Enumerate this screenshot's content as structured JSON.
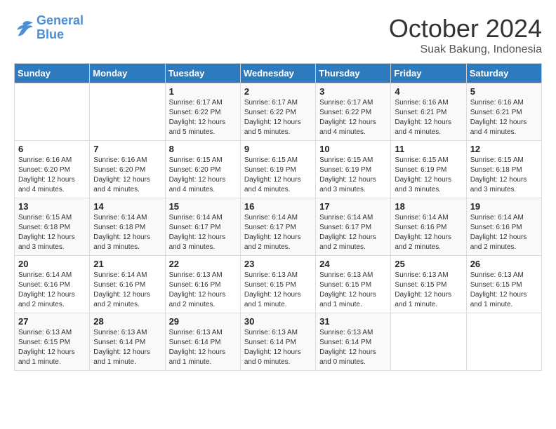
{
  "header": {
    "logo_line1": "General",
    "logo_line2": "Blue",
    "month_title": "October 2024",
    "subtitle": "Suak Bakung, Indonesia"
  },
  "days_of_week": [
    "Sunday",
    "Monday",
    "Tuesday",
    "Wednesday",
    "Thursday",
    "Friday",
    "Saturday"
  ],
  "weeks": [
    [
      {
        "day": "",
        "info": ""
      },
      {
        "day": "",
        "info": ""
      },
      {
        "day": "1",
        "info": "Sunrise: 6:17 AM\nSunset: 6:22 PM\nDaylight: 12 hours\nand 5 minutes."
      },
      {
        "day": "2",
        "info": "Sunrise: 6:17 AM\nSunset: 6:22 PM\nDaylight: 12 hours\nand 5 minutes."
      },
      {
        "day": "3",
        "info": "Sunrise: 6:17 AM\nSunset: 6:22 PM\nDaylight: 12 hours\nand 4 minutes."
      },
      {
        "day": "4",
        "info": "Sunrise: 6:16 AM\nSunset: 6:21 PM\nDaylight: 12 hours\nand 4 minutes."
      },
      {
        "day": "5",
        "info": "Sunrise: 6:16 AM\nSunset: 6:21 PM\nDaylight: 12 hours\nand 4 minutes."
      }
    ],
    [
      {
        "day": "6",
        "info": "Sunrise: 6:16 AM\nSunset: 6:20 PM\nDaylight: 12 hours\nand 4 minutes."
      },
      {
        "day": "7",
        "info": "Sunrise: 6:16 AM\nSunset: 6:20 PM\nDaylight: 12 hours\nand 4 minutes."
      },
      {
        "day": "8",
        "info": "Sunrise: 6:15 AM\nSunset: 6:20 PM\nDaylight: 12 hours\nand 4 minutes."
      },
      {
        "day": "9",
        "info": "Sunrise: 6:15 AM\nSunset: 6:19 PM\nDaylight: 12 hours\nand 4 minutes."
      },
      {
        "day": "10",
        "info": "Sunrise: 6:15 AM\nSunset: 6:19 PM\nDaylight: 12 hours\nand 3 minutes."
      },
      {
        "day": "11",
        "info": "Sunrise: 6:15 AM\nSunset: 6:19 PM\nDaylight: 12 hours\nand 3 minutes."
      },
      {
        "day": "12",
        "info": "Sunrise: 6:15 AM\nSunset: 6:18 PM\nDaylight: 12 hours\nand 3 minutes."
      }
    ],
    [
      {
        "day": "13",
        "info": "Sunrise: 6:15 AM\nSunset: 6:18 PM\nDaylight: 12 hours\nand 3 minutes."
      },
      {
        "day": "14",
        "info": "Sunrise: 6:14 AM\nSunset: 6:18 PM\nDaylight: 12 hours\nand 3 minutes."
      },
      {
        "day": "15",
        "info": "Sunrise: 6:14 AM\nSunset: 6:17 PM\nDaylight: 12 hours\nand 3 minutes."
      },
      {
        "day": "16",
        "info": "Sunrise: 6:14 AM\nSunset: 6:17 PM\nDaylight: 12 hours\nand 2 minutes."
      },
      {
        "day": "17",
        "info": "Sunrise: 6:14 AM\nSunset: 6:17 PM\nDaylight: 12 hours\nand 2 minutes."
      },
      {
        "day": "18",
        "info": "Sunrise: 6:14 AM\nSunset: 6:16 PM\nDaylight: 12 hours\nand 2 minutes."
      },
      {
        "day": "19",
        "info": "Sunrise: 6:14 AM\nSunset: 6:16 PM\nDaylight: 12 hours\nand 2 minutes."
      }
    ],
    [
      {
        "day": "20",
        "info": "Sunrise: 6:14 AM\nSunset: 6:16 PM\nDaylight: 12 hours\nand 2 minutes."
      },
      {
        "day": "21",
        "info": "Sunrise: 6:14 AM\nSunset: 6:16 PM\nDaylight: 12 hours\nand 2 minutes."
      },
      {
        "day": "22",
        "info": "Sunrise: 6:13 AM\nSunset: 6:16 PM\nDaylight: 12 hours\nand 2 minutes."
      },
      {
        "day": "23",
        "info": "Sunrise: 6:13 AM\nSunset: 6:15 PM\nDaylight: 12 hours\nand 1 minute."
      },
      {
        "day": "24",
        "info": "Sunrise: 6:13 AM\nSunset: 6:15 PM\nDaylight: 12 hours\nand 1 minute."
      },
      {
        "day": "25",
        "info": "Sunrise: 6:13 AM\nSunset: 6:15 PM\nDaylight: 12 hours\nand 1 minute."
      },
      {
        "day": "26",
        "info": "Sunrise: 6:13 AM\nSunset: 6:15 PM\nDaylight: 12 hours\nand 1 minute."
      }
    ],
    [
      {
        "day": "27",
        "info": "Sunrise: 6:13 AM\nSunset: 6:15 PM\nDaylight: 12 hours\nand 1 minute."
      },
      {
        "day": "28",
        "info": "Sunrise: 6:13 AM\nSunset: 6:14 PM\nDaylight: 12 hours\nand 1 minute."
      },
      {
        "day": "29",
        "info": "Sunrise: 6:13 AM\nSunset: 6:14 PM\nDaylight: 12 hours\nand 1 minute."
      },
      {
        "day": "30",
        "info": "Sunrise: 6:13 AM\nSunset: 6:14 PM\nDaylight: 12 hours\nand 0 minutes."
      },
      {
        "day": "31",
        "info": "Sunrise: 6:13 AM\nSunset: 6:14 PM\nDaylight: 12 hours\nand 0 minutes."
      },
      {
        "day": "",
        "info": ""
      },
      {
        "day": "",
        "info": ""
      }
    ]
  ]
}
